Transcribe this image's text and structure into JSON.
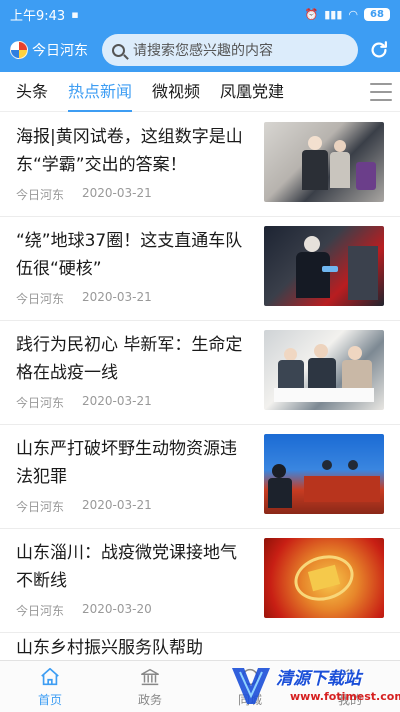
{
  "status_bar": {
    "time": "上午9:43",
    "battery": "68"
  },
  "header": {
    "app_name": "今日河东",
    "search_placeholder": "请搜索您感兴趣的内容"
  },
  "tabs": [
    {
      "label": "头条"
    },
    {
      "label": "热点新闻",
      "active": true
    },
    {
      "label": "微视频"
    },
    {
      "label": "凤凰党建"
    }
  ],
  "articles": [
    {
      "title": "海报|黄冈试卷，这组数字是山东“学霸”交出的答案！",
      "source": "今日河东",
      "date": "2020-03-21"
    },
    {
      "title": "“绕”地球37圈！这支直通车队伍很“硬核”",
      "source": "今日河东",
      "date": "2020-03-21"
    },
    {
      "title": "践行为民初心 毕新军：生命定格在战疫一线",
      "source": "今日河东",
      "date": "2020-03-21"
    },
    {
      "title": "山东严打破坏野生动物资源违法犯罪",
      "source": "今日河东",
      "date": "2020-03-21"
    },
    {
      "title": "山东淄川：战疫微党课接地气不断线",
      "source": "今日河东",
      "date": "2020-03-20"
    }
  ],
  "partial_article": {
    "title": "山东乡村振兴服务队帮助"
  },
  "bottom_nav": [
    {
      "label": "首页",
      "icon": "home-icon",
      "active": true
    },
    {
      "label": "政务",
      "icon": "government-icon"
    },
    {
      "label": "同城",
      "icon": "city-icon"
    },
    {
      "label": "我的",
      "icon": "user-icon"
    }
  ],
  "watermark": {
    "text": "清源下载站",
    "url": "www.fotimest.com"
  },
  "colors": {
    "accent": "#3d9df3",
    "meta_text": "#999999"
  }
}
